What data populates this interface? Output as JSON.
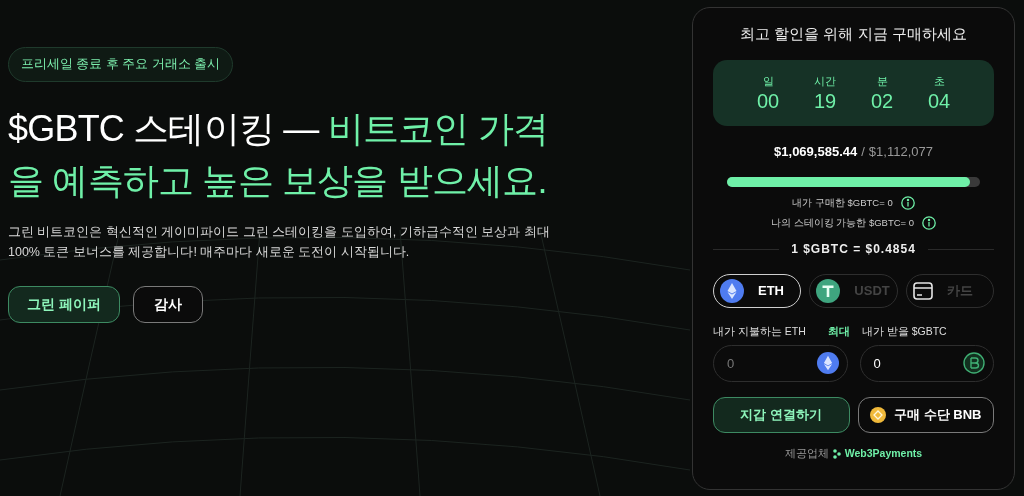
{
  "badge": "프리세일 종료 후 주요 거래소 출시",
  "headline": {
    "white": "$GBTC 스테이킹 —",
    "green": "비트코인 가격을 예측하고 높은 보상을 받으세요."
  },
  "description": "그린 비트코인은 혁신적인 게이미파이드 그린 스테이킹을 도입하여, 기하급수적인 보상과 최대 100% 토큰 보너스를 제공합니다! 매주마다 새로운 도전이 시작됩니다.",
  "hero_buttons": [
    {
      "label": "그린 페이퍼",
      "kind": "primary"
    },
    {
      "label": "감사",
      "kind": "outline"
    }
  ],
  "widget": {
    "title": "최고 할인을 위해 지금 구매하세요",
    "countdown": [
      {
        "unit": "일",
        "value": "00"
      },
      {
        "unit": "시간",
        "value": "19"
      },
      {
        "unit": "분",
        "value": "02"
      },
      {
        "unit": "초",
        "value": "04"
      }
    ],
    "raised": "$1,069,585.44",
    "separator": "/",
    "goal": "$1,112,077",
    "progress": {
      "level": 0.96
    },
    "balances": [
      "내가 구매한 $GBTC= 0",
      "나의 스테이킹 가능한 $GBTC= 0"
    ],
    "rate": "1 $GBTC = $0.4854",
    "payment_tabs": [
      {
        "label": "ETH",
        "kind": "eth",
        "selected": true
      },
      {
        "label": "USDT",
        "kind": "usdt",
        "selected": false
      },
      {
        "label": "카드",
        "kind": "card",
        "selected": false
      }
    ],
    "pay_label": "내가 지불하는 ETH",
    "max_link": "최대",
    "receive_label": "내가 받을 $GBTC",
    "pay_input": {
      "placeholder": "0"
    },
    "receive_input": {
      "value": "0"
    },
    "actions": [
      {
        "label": "지갑 연결하기",
        "kind": "primary"
      },
      {
        "label": "구매 수단 BNB",
        "kind": "bnb"
      }
    ],
    "provider_label": "제공업체",
    "provider_name": "Web3Payments"
  }
}
